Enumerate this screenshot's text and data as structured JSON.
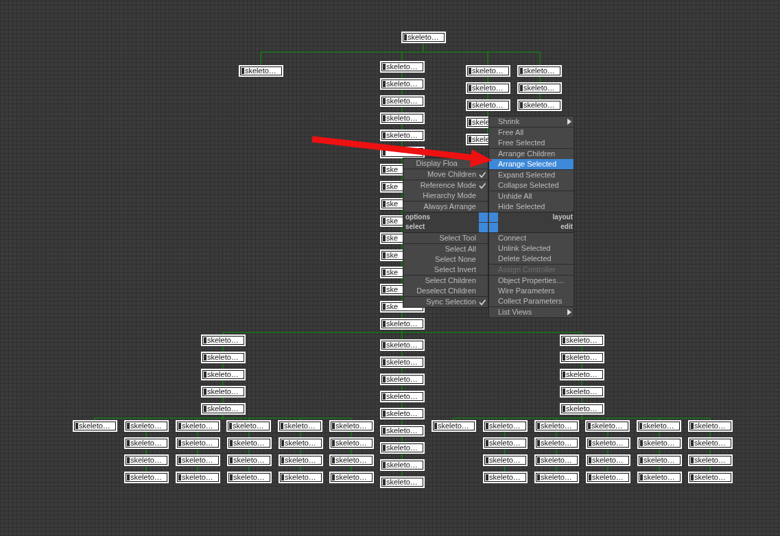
{
  "schematic": {
    "node_groups": [
      {
        "nodes": [
          "skeleto…"
        ]
      },
      {
        "nodes": [
          "skeleto…"
        ]
      },
      {
        "nodes": [
          "skeleto…",
          "skeleto…",
          "skeleto…",
          "skeleto…",
          "skeleto…"
        ]
      },
      {
        "nodes": [
          "ske",
          "ske",
          "ske",
          "ske",
          "ske",
          "ske",
          "ske",
          "ske",
          "ske",
          "skeleto…"
        ]
      },
      {
        "nodes": [
          "skeleto…",
          "skeleto…",
          "skeleto…",
          "skele",
          "skele"
        ]
      },
      {
        "nodes": [
          "skeleto…",
          "skeleto…",
          "skeleto…"
        ]
      },
      {
        "nodes": [
          "skeleto…",
          "skeleto…",
          "skeleto…",
          "skeleto…",
          "skeleto…"
        ]
      },
      {
        "nodes": [
          "skeleto…",
          "skeleto…",
          "skeleto…",
          "skeleto…",
          "skeleto…",
          "skeleto…",
          "skeleto…",
          "skeleto…",
          "skeleto…"
        ]
      },
      {
        "nodes": [
          "skeleto…",
          "skeleto…",
          "skeleto…",
          "skeleto…",
          "skeleto…"
        ]
      },
      {
        "nodes": [
          "skeleto…",
          "skeleto…",
          "skeleto…",
          "skeleto…",
          "skeleto…",
          "skeleto…"
        ]
      },
      {
        "nodes": [
          "skeleto…",
          "skeleto…",
          "skeleto…"
        ]
      },
      {
        "nodes": [
          "skeleto…",
          "skeleto…",
          "skeleto…"
        ]
      },
      {
        "nodes": [
          "skeleto…",
          "skeleto…",
          "skeleto…"
        ]
      },
      {
        "nodes": [
          "skeleto…",
          "skeleto…",
          "skeleto…"
        ]
      },
      {
        "nodes": [
          "skeleto…",
          "skeleto…",
          "skeleto…"
        ]
      },
      {
        "nodes": [
          "skeleto…",
          "skeleto…",
          "skeleto…",
          "skeleto…",
          "skeleto…",
          "skeleto…"
        ]
      },
      {
        "nodes": [
          "skeleto…",
          "skeleto…",
          "skeleto…"
        ]
      },
      {
        "nodes": [
          "skeleto…",
          "skeleto…",
          "skeleto…"
        ]
      },
      {
        "nodes": [
          "skeleto…",
          "skeleto…",
          "skeleto…"
        ]
      },
      {
        "nodes": [
          "skeleto…",
          "skeleto…",
          "skeleto…"
        ]
      },
      {
        "nodes": [
          "skeleto…",
          "skeleto…",
          "skeleto…"
        ]
      }
    ]
  },
  "quad_menu": {
    "quadrants": [
      {
        "title": "options",
        "sections": [
          [
            {
              "label": "Display Floa",
              "selected": false,
              "disabled": false
            }
          ],
          [
            {
              "label": "Move Children",
              "checked": true,
              "selected": false,
              "disabled": false
            }
          ],
          [
            {
              "label": "Reference Mode",
              "checked": true,
              "selected": false,
              "disabled": false
            },
            {
              "label": "Hierarchy Mode",
              "checked": false,
              "selected": false,
              "disabled": false
            }
          ],
          [
            {
              "label": "Always Arrange",
              "checked": false,
              "selected": false,
              "disabled": false
            }
          ]
        ]
      },
      {
        "title": "select",
        "sections": [
          [
            {
              "label": "Select Tool",
              "checked": false,
              "selected": false,
              "disabled": false
            }
          ],
          [
            {
              "label": "Select All",
              "checked": false,
              "selected": false,
              "disabled": false
            },
            {
              "label": "Select None",
              "checked": false,
              "selected": false,
              "disabled": false
            },
            {
              "label": "Select Invert",
              "checked": false,
              "selected": false,
              "disabled": false
            }
          ],
          [
            {
              "label": "Select Children",
              "checked": false,
              "selected": false,
              "disabled": false
            },
            {
              "label": "Deselect Children",
              "checked": false,
              "selected": false,
              "disabled": false
            }
          ],
          [
            {
              "label": "Sync Selection",
              "checked": true,
              "selected": false,
              "disabled": false
            }
          ]
        ]
      },
      {
        "title": "layout",
        "sections": [
          [
            {
              "label": "Shrink",
              "submenu": true,
              "selected": false,
              "disabled": false
            }
          ],
          [
            {
              "label": "Free All",
              "submenu": false,
              "selected": false,
              "disabled": false
            },
            {
              "label": "Free Selected",
              "submenu": false,
              "selected": false,
              "disabled": false
            }
          ],
          [
            {
              "label": "Arrange Children",
              "submenu": false,
              "selected": false,
              "disabled": false
            },
            {
              "label": "Arrange Selected",
              "submenu": false,
              "selected": true,
              "disabled": false
            }
          ],
          [
            {
              "label": "Expand Selected",
              "submenu": false,
              "selected": false,
              "disabled": false
            },
            {
              "label": "Collapse Selected",
              "submenu": false,
              "selected": false,
              "disabled": false
            }
          ],
          [
            {
              "label": "Unhide All",
              "submenu": false,
              "selected": false,
              "disabled": false
            },
            {
              "label": "Hide Selected",
              "submenu": false,
              "selected": false,
              "disabled": false
            }
          ]
        ]
      },
      {
        "title": "edit",
        "sections": [
          [
            {
              "label": "Connect",
              "submenu": false,
              "selected": false,
              "disabled": false
            },
            {
              "label": "Unlink Selected",
              "submenu": false,
              "selected": false,
              "disabled": false
            },
            {
              "label": "Delete Selected",
              "submenu": false,
              "selected": false,
              "disabled": false
            }
          ],
          [
            {
              "label": "Assign Controller",
              "submenu": false,
              "selected": false,
              "disabled": true
            }
          ],
          [
            {
              "label": "Object Properties…",
              "submenu": false,
              "selected": false,
              "disabled": false
            },
            {
              "label": "Wire Parameters",
              "submenu": false,
              "selected": false,
              "disabled": false
            },
            {
              "label": "Collect Parameters",
              "submenu": false,
              "selected": false,
              "disabled": false
            }
          ],
          [
            {
              "label": "List Views",
              "submenu": true,
              "selected": false,
              "disabled": false
            }
          ]
        ]
      }
    ]
  }
}
